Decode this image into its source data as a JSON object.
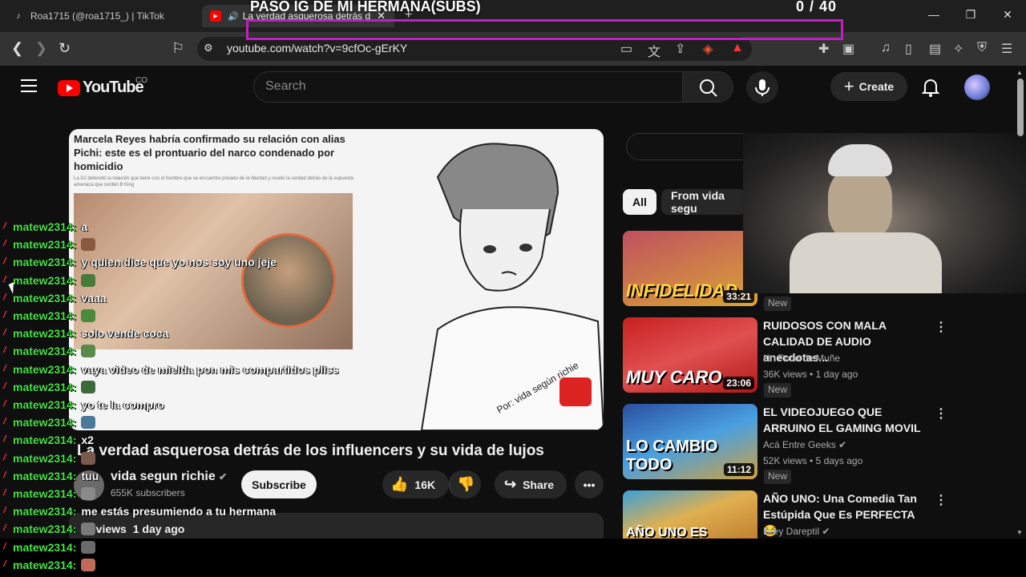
{
  "browser": {
    "tabs": [
      {
        "label": "Roa1715 (@roa1715_) | TikTok"
      },
      {
        "label": "La verdad asquerosa detrás d"
      }
    ],
    "url": "youtube.com/watch?v=9cfOc-gErKY"
  },
  "overlay": {
    "title": "PASO IG DE MI HERMANA(SUBS)",
    "counter": "0  / 40"
  },
  "youtube": {
    "logo": "YouTube",
    "region": "CO",
    "search_placeholder": "Search",
    "create_label": "Create"
  },
  "video": {
    "title": "La verdad asquerosa detrás de los influencers y su vida de lujos",
    "channel": "vida segun richie",
    "subscribers": "655K subscribers",
    "subscribe_label": "Subscribe",
    "likes": "16K",
    "share_label": "Share",
    "views": "5 views",
    "posted": "1 day ago",
    "article_headline": "Marcela Reyes habría confirmado su relación con alias Pichi: este es el prontuario del narco condenado por homicidio",
    "article_sub": "La DJ defendió la relación que tiene con el hombre que se encuentra privado de la libertad y reveló la verdad detrás de la supuesta amenaza que recibió B King",
    "watermark": "Por: vida según richie"
  },
  "sidebar": {
    "chips": [
      "All",
      "From vida segu"
    ],
    "videos": [
      {
        "caption": "INFIDELIDAD",
        "duration": "33:21",
        "title": "",
        "channel": "",
        "meta": "",
        "badge": "New",
        "thumb_color": "#d9a536"
      },
      {
        "caption": "MUY CARO",
        "duration": "23:06",
        "title": "RUIDOSOS CON MALA CALIDAD DE AUDIO anecdotas...",
        "channel": "Un Poco de Muñe",
        "meta": "36K views • 1 day ago",
        "badge": "New",
        "thumb_color": "#d93030"
      },
      {
        "caption": "LO CAMBIO TODO",
        "duration": "11:12",
        "title": "EL VIDEOJUEGO QUE ARRUINO EL GAMING MOVIL",
        "channel": "Acá Entre Geeks",
        "meta": "52K views • 5 days ago",
        "badge": "New",
        "thumb_color": "#3a6fd0"
      },
      {
        "caption": "AÑO UNO ES",
        "duration": "",
        "title": "AÑO UNO: Una Comedia Tan Estúpida Que Es PERFECTA 😂",
        "channel": "Drey Dareptil",
        "meta": "",
        "badge": "",
        "thumb_color": "#3aa0d8"
      }
    ]
  },
  "chat": [
    {
      "user": "matew2314:",
      "msg": "a"
    },
    {
      "user": "matew2314:",
      "msg": "",
      "emote": "#8a5a40"
    },
    {
      "user": "matew2314:",
      "msg": "y quien dice que yo nos soy uno jeje"
    },
    {
      "user": "matew2314:",
      "msg": "",
      "emote": "#4a7a3a"
    },
    {
      "user": "matew2314:",
      "msg": "vaaa"
    },
    {
      "user": "matew2314:",
      "msg": "",
      "emote": "#4a8a3a"
    },
    {
      "user": "matew2314:",
      "msg": "solo vende coca"
    },
    {
      "user": "matew2314:",
      "msg": "",
      "emote": "#5a8a4a"
    },
    {
      "user": "matew2314:",
      "msg": "vaya video de mielda pon mis compartidos pliss"
    },
    {
      "user": "matew2314:",
      "msg": "",
      "emote": "#3a6a3a"
    },
    {
      "user": "matew2314:",
      "msg": "yo te la compro"
    },
    {
      "user": "matew2314:",
      "msg": "",
      "emote": "#4a7a9a"
    },
    {
      "user": "matew2314:",
      "msg": "x2"
    },
    {
      "user": "matew2314:",
      "msg": "",
      "emote": "#7a5a4a"
    },
    {
      "user": "matew2314:",
      "msg": "tuu"
    },
    {
      "user": "matew2314:",
      "msg": "",
      "emote": "#8a8a8a"
    },
    {
      "user": "matew2314:",
      "msg": "me estás presumiendo a tu hermana"
    },
    {
      "user": "matew2314:",
      "msg": "",
      "emote": "#7a7a7a"
    },
    {
      "user": "matew2314:",
      "msg": "",
      "emote": "#6a6a6a"
    },
    {
      "user": "matew2314:",
      "msg": "",
      "emote": "#c06a5a"
    }
  ],
  "colors": {
    "accent": "#ff0000",
    "chat_user": "#4ae24a",
    "overlay_border": "#c020c0"
  }
}
